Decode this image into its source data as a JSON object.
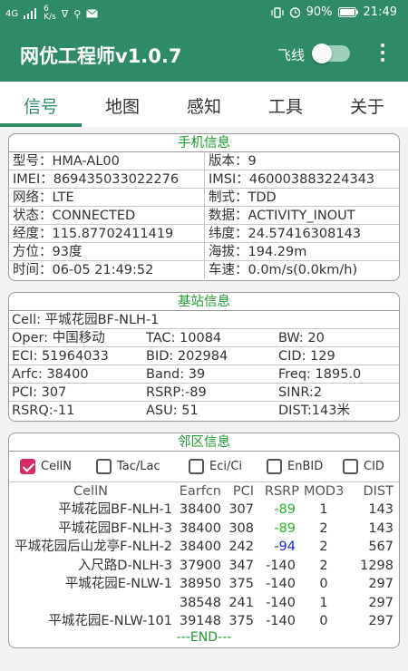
{
  "status": {
    "net": "4G",
    "speed_num": "6",
    "speed_unit": "K/s",
    "battery": "90%",
    "time": "21:49",
    "colors": {
      "bar": "#2e8b66"
    }
  },
  "app": {
    "title": "网优工程师v1.0.7",
    "fly_label": "飞线"
  },
  "tabs": [
    "信号",
    "地图",
    "感知",
    "工具",
    "关于"
  ],
  "phone": {
    "title": "手机信息",
    "rows": [
      [
        "型号：HMA-AL00",
        "版本：9"
      ],
      [
        "IMEI：869435033022276",
        "IMSI：460003883224343"
      ],
      [
        "网络：LTE",
        "制式：TDD"
      ],
      [
        "状态：CONNECTED",
        "数据：ACTIVITY_INOUT"
      ],
      [
        "经度：115.87702411419",
        "纬度：24.57416308143"
      ],
      [
        "方位：93度",
        "海拔：194.29m"
      ],
      [
        "时间：06-05 21:49:52",
        "车速：0.0m/s(0.0km/h)"
      ]
    ]
  },
  "station": {
    "title": "基站信息",
    "cell": "Cell:  平城花园BF-NLH-1",
    "rows": [
      [
        "Oper:  中国移动",
        "TAC:  10084",
        "BW:  20"
      ],
      [
        "ECI:   51964033",
        "BID:  202984",
        "CID:  129"
      ],
      [
        "Arfc:  38400",
        "Band: 39",
        "Freq: 1895.0"
      ],
      [
        "PCI:   307",
        "RSRP:-89",
        "SINR:2"
      ],
      [
        "RSRQ:-11",
        "ASU:   51",
        "DIST:143米"
      ]
    ]
  },
  "neighbor": {
    "title": "邻区信息",
    "checks": [
      {
        "label": "CellN",
        "checked": true
      },
      {
        "label": "Tac/Lac",
        "checked": false
      },
      {
        "label": "Eci/Ci",
        "checked": false
      },
      {
        "label": "EnBID",
        "checked": false
      },
      {
        "label": "CID",
        "checked": false
      }
    ],
    "headers": [
      "CellN",
      "Earfcn",
      "PCI",
      "RSRP",
      "MOD3",
      "DIST"
    ],
    "rows": [
      {
        "cell": "平城花园BF-NLH-1",
        "earfcn": "38400",
        "pci": "307",
        "rsrp": "-89",
        "rsrp_color": "green",
        "mod3": "1",
        "dist": "143"
      },
      {
        "cell": "平城花园BF-NLH-3",
        "earfcn": "38400",
        "pci": "308",
        "rsrp": "-89",
        "rsrp_color": "green",
        "mod3": "2",
        "dist": "143"
      },
      {
        "cell": "平城花园后山龙亭F-NLH-2",
        "earfcn": "38400",
        "pci": "242",
        "rsrp": "-94",
        "rsrp_color": "blue",
        "mod3": "2",
        "dist": "567"
      },
      {
        "cell": "入尺路D-NLH-3",
        "earfcn": "37900",
        "pci": "347",
        "rsrp": "-140",
        "rsrp_color": "normal",
        "mod3": "2",
        "dist": "1298"
      },
      {
        "cell": "平城花园E-NLW-1",
        "earfcn": "38950",
        "pci": "375",
        "rsrp": "-140",
        "rsrp_color": "normal",
        "mod3": "0",
        "dist": "297"
      },
      {
        "cell": "",
        "earfcn": "38548",
        "pci": "241",
        "rsrp": "-140",
        "rsrp_color": "normal",
        "mod3": "1",
        "dist": "297"
      },
      {
        "cell": "平城花园E-NLW-101",
        "earfcn": "39148",
        "pci": "375",
        "rsrp": "-140",
        "rsrp_color": "normal",
        "mod3": "0",
        "dist": "297"
      }
    ],
    "end": "---END---"
  }
}
